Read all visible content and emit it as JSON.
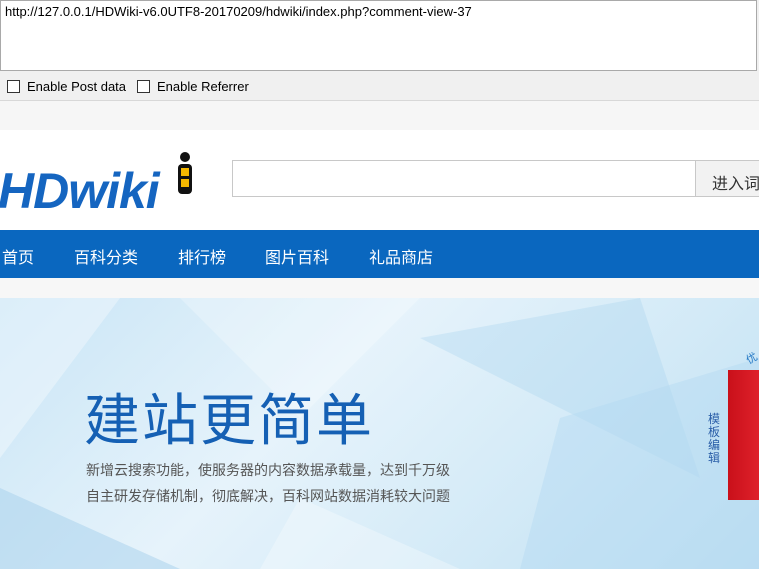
{
  "url_bar": {
    "value": "http://127.0.0.1/HDWiki-v6.0UTF8-20170209/hdwiki/index.php?comment-view-37"
  },
  "options": {
    "post_data": "Enable Post data",
    "referrer": "Enable Referrer"
  },
  "header": {
    "logo": "HDwiki",
    "search_placeholder": "",
    "search_button": "进入词"
  },
  "nav": {
    "items": [
      "首页",
      "百科分类",
      "排行榜",
      "图片百科",
      "礼品商店"
    ]
  },
  "banner": {
    "title": "建站更简单",
    "line1": "新增云搜索功能，使服务器的内容数据承载量，达到千万级",
    "line2": "自主研发存储机制，彻底解决，百科网站数据消耗较大问题",
    "side_label": "模板编辑",
    "corner_label": "优"
  },
  "colors": {
    "brand_blue": "#0a67bf",
    "title_blue": "#1560b4",
    "red": "#d9161f"
  }
}
